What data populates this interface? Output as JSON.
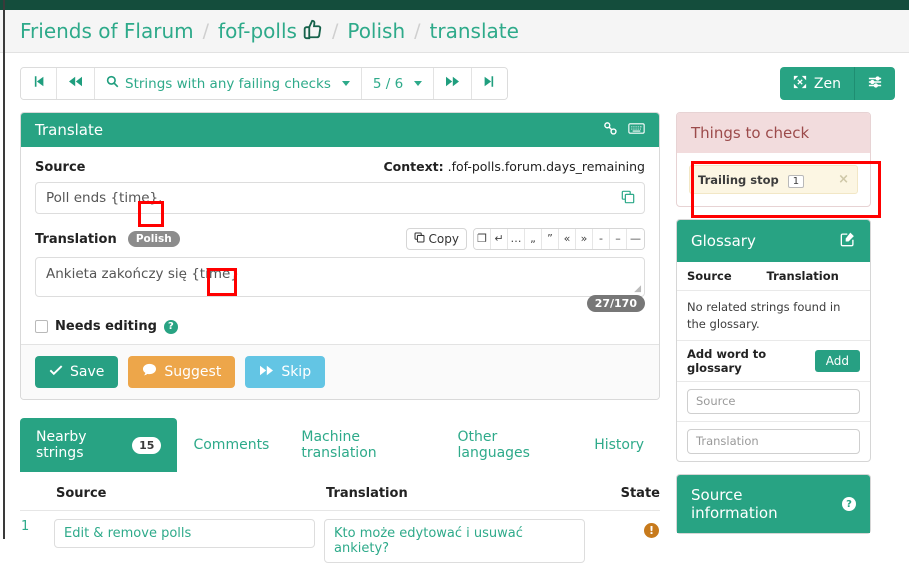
{
  "breadcrumb": {
    "items": [
      {
        "label": "Friends of Flarum"
      },
      {
        "label": "fof-polls",
        "icon": "thumbs-up-icon"
      },
      {
        "label": "Polish"
      },
      {
        "label": "translate"
      }
    ],
    "separator": "/"
  },
  "toolbar": {
    "first_label": "⏮",
    "prev_label": "⏪",
    "search_label": "Strings with any failing checks",
    "search_icon": "search-icon",
    "position_label": "5 / 6",
    "next_label": "⏩",
    "last_label": "⏭",
    "zen_label": "Zen",
    "zen_icon": "expand-arrows-icon",
    "settings_icon": "sliders-icon"
  },
  "translate_card": {
    "title": "Translate",
    "permalink_icon": "chain-cogs-icon",
    "keyboard_icon": "keyboard-icon",
    "source_label": "Source",
    "context_prefix": "Context:",
    "context_value": ".fof-polls.forum.days_remaining",
    "source_text": "Poll ends {time}.",
    "copy_source_icon": "copy-icon",
    "translation_label": "Translation",
    "translation_lang": "Polish",
    "copy_button_label": "Copy",
    "copy_button_icon": "copy-icon",
    "char_buttons": [
      {
        "name": "insert-source-icon",
        "glyph": "❐"
      },
      {
        "name": "newline-icon",
        "glyph": "↵"
      },
      {
        "name": "ellipsis-char",
        "glyph": "…"
      },
      {
        "name": "low-quote-char",
        "glyph": "„"
      },
      {
        "name": "high-quote-char",
        "glyph": "”"
      },
      {
        "name": "left-guillemet-char",
        "glyph": "«"
      },
      {
        "name": "right-guillemet-char",
        "glyph": "»"
      },
      {
        "name": "hyphen-char",
        "glyph": "-"
      },
      {
        "name": "en-dash-char",
        "glyph": "–"
      },
      {
        "name": "em-dash-char",
        "glyph": "—"
      }
    ],
    "translation_text": "Ankieta zakończy się {time}",
    "char_counter": "27/170",
    "needs_editing_label": "Needs editing",
    "needs_editing_checked": false,
    "help_icon": "question-circle-icon",
    "save_label": "Save",
    "save_icon": "check-icon",
    "suggest_label": "Suggest",
    "suggest_icon": "comment-icon",
    "skip_label": "Skip",
    "skip_icon": "forward-icon"
  },
  "tabs": [
    {
      "label": "Nearby strings",
      "count": "15",
      "active": true
    },
    {
      "label": "Comments",
      "count": null,
      "active": false
    },
    {
      "label": "Machine translation",
      "count": null,
      "active": false
    },
    {
      "label": "Other languages",
      "count": null,
      "active": false
    },
    {
      "label": "History",
      "count": null,
      "active": false
    }
  ],
  "nearby_table": {
    "headers": [
      "",
      "Source",
      "Translation",
      "State"
    ],
    "rows": [
      {
        "num": "1",
        "source": "Edit & remove polls",
        "translation": "Kto może edytować i usuwać ankiety?",
        "state_icon": "warning-exclamation-icon"
      }
    ]
  },
  "sidebar": {
    "things_to_check": {
      "title": "Things to check",
      "checks": [
        {
          "label": "Trailing stop",
          "count": "1",
          "dismiss_icon": "close-icon"
        }
      ]
    },
    "glossary": {
      "title": "Glossary",
      "edit_icon": "pencil-square-icon",
      "headers": [
        "Source",
        "Translation"
      ],
      "empty_text": "No related strings found in the glossary.",
      "add_label": "Add word to glossary",
      "add_button": "Add",
      "source_placeholder": "Source",
      "translation_placeholder": "Translation"
    },
    "source_information": {
      "title": "Source information",
      "help_icon": "question-circle-icon"
    }
  },
  "colors": {
    "brand_dark": "#144d3c",
    "brand_green": "#28a383",
    "link_green": "#2eaa8a",
    "suggest_orange": "#eda64a",
    "skip_blue": "#63c5e4",
    "annotation_red": "#ff0000",
    "check_pink": "#f2dcdd"
  }
}
